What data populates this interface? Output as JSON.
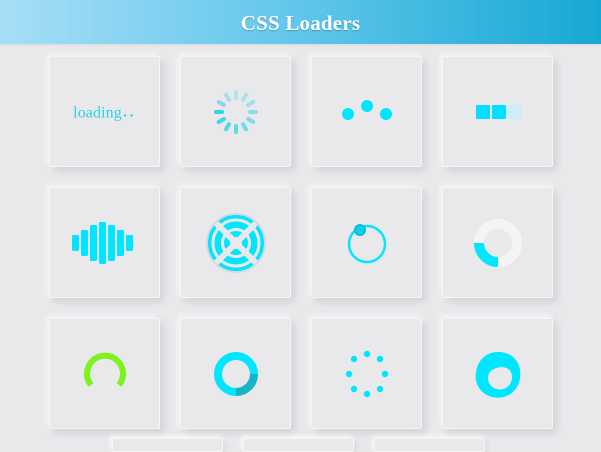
{
  "header": {
    "title": "CSS Loaders"
  },
  "loaders": [
    {
      "type": "text",
      "text": "loading",
      "dots": ".."
    },
    {
      "type": "spinner-dashes",
      "color": "#2ad2e6"
    },
    {
      "type": "three-dots",
      "color": "#00e6ff"
    },
    {
      "type": "squares",
      "color": "#00dfff"
    },
    {
      "type": "equalizer-bars",
      "color": "#00e6ff"
    },
    {
      "type": "target-rings",
      "color": "#00e6ff"
    },
    {
      "type": "orbit-dot-ring",
      "color": "#00e6ff"
    },
    {
      "type": "arc-ring",
      "color": "#00e6ff"
    },
    {
      "type": "arc-green",
      "color": "#7df21d"
    },
    {
      "type": "donut-teal",
      "color": "#00e6ff"
    },
    {
      "type": "dot-ring",
      "color": "#00e6ff"
    },
    {
      "type": "blob-ring",
      "color": "#00e6ff"
    }
  ],
  "colors": {
    "background": "#e9e9ec",
    "header_gradient_start": "#a7def6",
    "header_gradient_end": "#16a8d3",
    "cyan": "#00e6ff",
    "green": "#7df21d"
  }
}
